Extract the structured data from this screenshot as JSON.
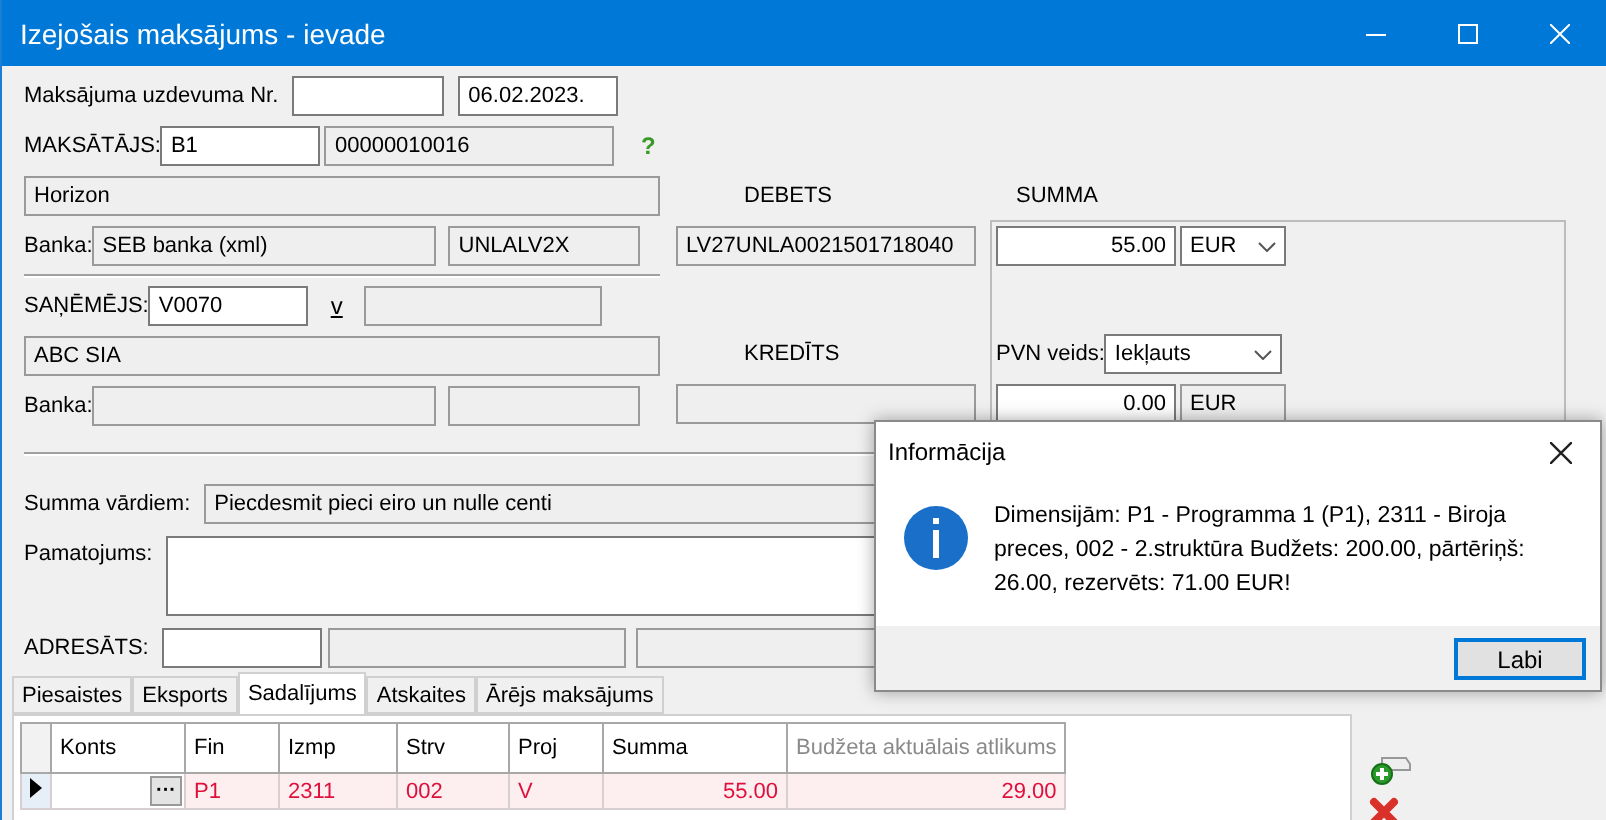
{
  "window": {
    "title": "Izejošais maksājums - ievade"
  },
  "payment_no": {
    "label": "Maksājuma uzdevuma Nr.",
    "date": "06.02.2023."
  },
  "payer": {
    "label": "MAKSĀTĀJS:",
    "code": "B1",
    "reg_no": "00000010016",
    "help": "?",
    "name": "Horizon",
    "bank_label": "Banka:",
    "bank": "SEB banka (xml)",
    "swift": "UNLALV2X"
  },
  "debit": {
    "label": "DEBETS",
    "account": "LV27UNLA0021501718040"
  },
  "amount": {
    "label": "SUMMA",
    "value": "55.00",
    "currency": "EUR"
  },
  "payee": {
    "label": "SAŅĒMĒJS:",
    "code": "V0070",
    "link": "v",
    "name": "ABC SIA",
    "bank_label": "Banka:"
  },
  "credit": {
    "label": "KREDĪTS"
  },
  "vat": {
    "label": "PVN veids:",
    "type": "Iekļauts",
    "value": "0.00",
    "currency": "EUR"
  },
  "sum_words": {
    "label": "Summa vārdiem:",
    "value": "Piecdesmit pieci eiro un nulle centi"
  },
  "justification": {
    "label": "Pamatojums:"
  },
  "addressee": {
    "label": "ADRESĀTS:"
  },
  "tabs": [
    {
      "label": "Piesaistes",
      "selected": false
    },
    {
      "label": "Eksports",
      "selected": false
    },
    {
      "label": "Sadalījums",
      "selected": true
    },
    {
      "label": "Atskaites",
      "selected": false
    },
    {
      "label": "Ārējs maksājums",
      "selected": false
    }
  ],
  "table": {
    "columns": [
      {
        "label": "Konts",
        "readonly": false
      },
      {
        "label": "Fin",
        "readonly": false
      },
      {
        "label": "Izmp",
        "readonly": false
      },
      {
        "label": "Strv",
        "readonly": false
      },
      {
        "label": "Proj",
        "readonly": false
      },
      {
        "label": "Summa",
        "readonly": false
      },
      {
        "label": "Budžeta aktuālais atlikums",
        "readonly": true
      }
    ],
    "rows": [
      {
        "current": true,
        "highlight": true,
        "cells": [
          "···",
          "P1",
          "2311",
          "002",
          "V",
          "55.00",
          "29.00"
        ]
      }
    ]
  },
  "dialog": {
    "title": "Informācija",
    "message": "Dimensijām: P1 - Programma 1 (P1), 2311 - Biroja preces, 002 - 2.struktūra Budžets: 200.00, pārtēriņš: 26.00, rezervēts: 71.00 EUR!",
    "button": "Labi"
  }
}
